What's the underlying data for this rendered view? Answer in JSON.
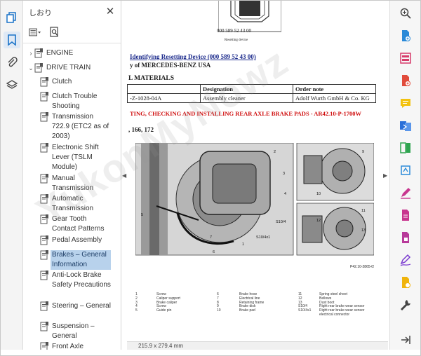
{
  "panel": {
    "title": "しおり",
    "close_glyph": "✕",
    "tools": [
      {
        "icon": "options-menu-icon"
      },
      {
        "icon": "search-bookmark-icon"
      }
    ]
  },
  "bookmarks": [
    {
      "label": "ENGINE",
      "level": 0,
      "expanded": false
    },
    {
      "label": "DRIVE TRAIN",
      "level": 0,
      "expanded": true
    },
    {
      "label": "Clutch",
      "level": 1
    },
    {
      "label": "Clutch Trouble Shooting",
      "level": 1
    },
    {
      "label": "Transmission 722.9 (ETC2 as of 2003)",
      "level": 1
    },
    {
      "label": "Electronic Shift Lever (TSLM Module)",
      "level": 1
    },
    {
      "label": "Manual Transmission",
      "level": 1
    },
    {
      "label": "Automatic Transmission",
      "level": 1
    },
    {
      "label": "Gear Tooth Contact Patterns",
      "level": 1
    },
    {
      "label": "Pedal Assembly",
      "level": 1
    },
    {
      "label": "Brakes – General Information",
      "level": 1,
      "selected": true
    },
    {
      "label": "Anti-Lock Brake Safety Precautions",
      "level": 1
    },
    {
      "label": "Steering – General",
      "level": 1
    },
    {
      "label": "Suspension – General",
      "level": 1
    },
    {
      "label": "Front Axle",
      "level": 1
    }
  ],
  "document": {
    "device_partno": "000 589 52 43 00",
    "device_caption": "Resetting device",
    "link_line": "Identifying Resetting Device (000 589 52 43 00)",
    "company_line": "y of MERCEDES-BENZ USA",
    "materials_heading": "L MATERIALS",
    "table": {
      "headers": [
        "",
        "Designation",
        "Order note"
      ],
      "rows": [
        [
          "-Z-1028-04A",
          "Assembly cleaner",
          "Adolf Wurth GmbH & Co. KG"
        ]
      ]
    },
    "procedure_heading": "TING, CHECKING AND INSTALLING REAR AXLE BRAKE PADS - AR42.10-P-1700W",
    "models_line": ", 166, 172",
    "figure_id": "P42.10-2865-09",
    "figure_callouts": [
      "1",
      "2",
      "3",
      "4",
      "5",
      "6",
      "7",
      "8",
      "S10/4",
      "S10/4x1",
      "9",
      "10",
      "11",
      "12",
      "13"
    ],
    "legend_cols": [
      [
        "1",
        "2",
        "3",
        "4",
        "5"
      ],
      [
        "Screw",
        "Caliper support",
        "Brake caliper",
        "Screw",
        "Guide pin"
      ],
      [
        "6",
        "7",
        "8",
        "9",
        "10"
      ],
      [
        "Brake hose",
        "Electrical line",
        "Retaining frame",
        "Brake disk",
        "Brake pad"
      ],
      [
        "11",
        "12",
        "13",
        "S10/4",
        "S10/4x1"
      ],
      [
        "Spring steel sheet",
        "Bellows",
        "Dust boot",
        "Right rear brake wear sensor",
        "Right rear brake wear sensor electrical connector"
      ]
    ],
    "page_size": "215.9 x 279.4 mm"
  },
  "watermark": "YukonMyNowz"
}
